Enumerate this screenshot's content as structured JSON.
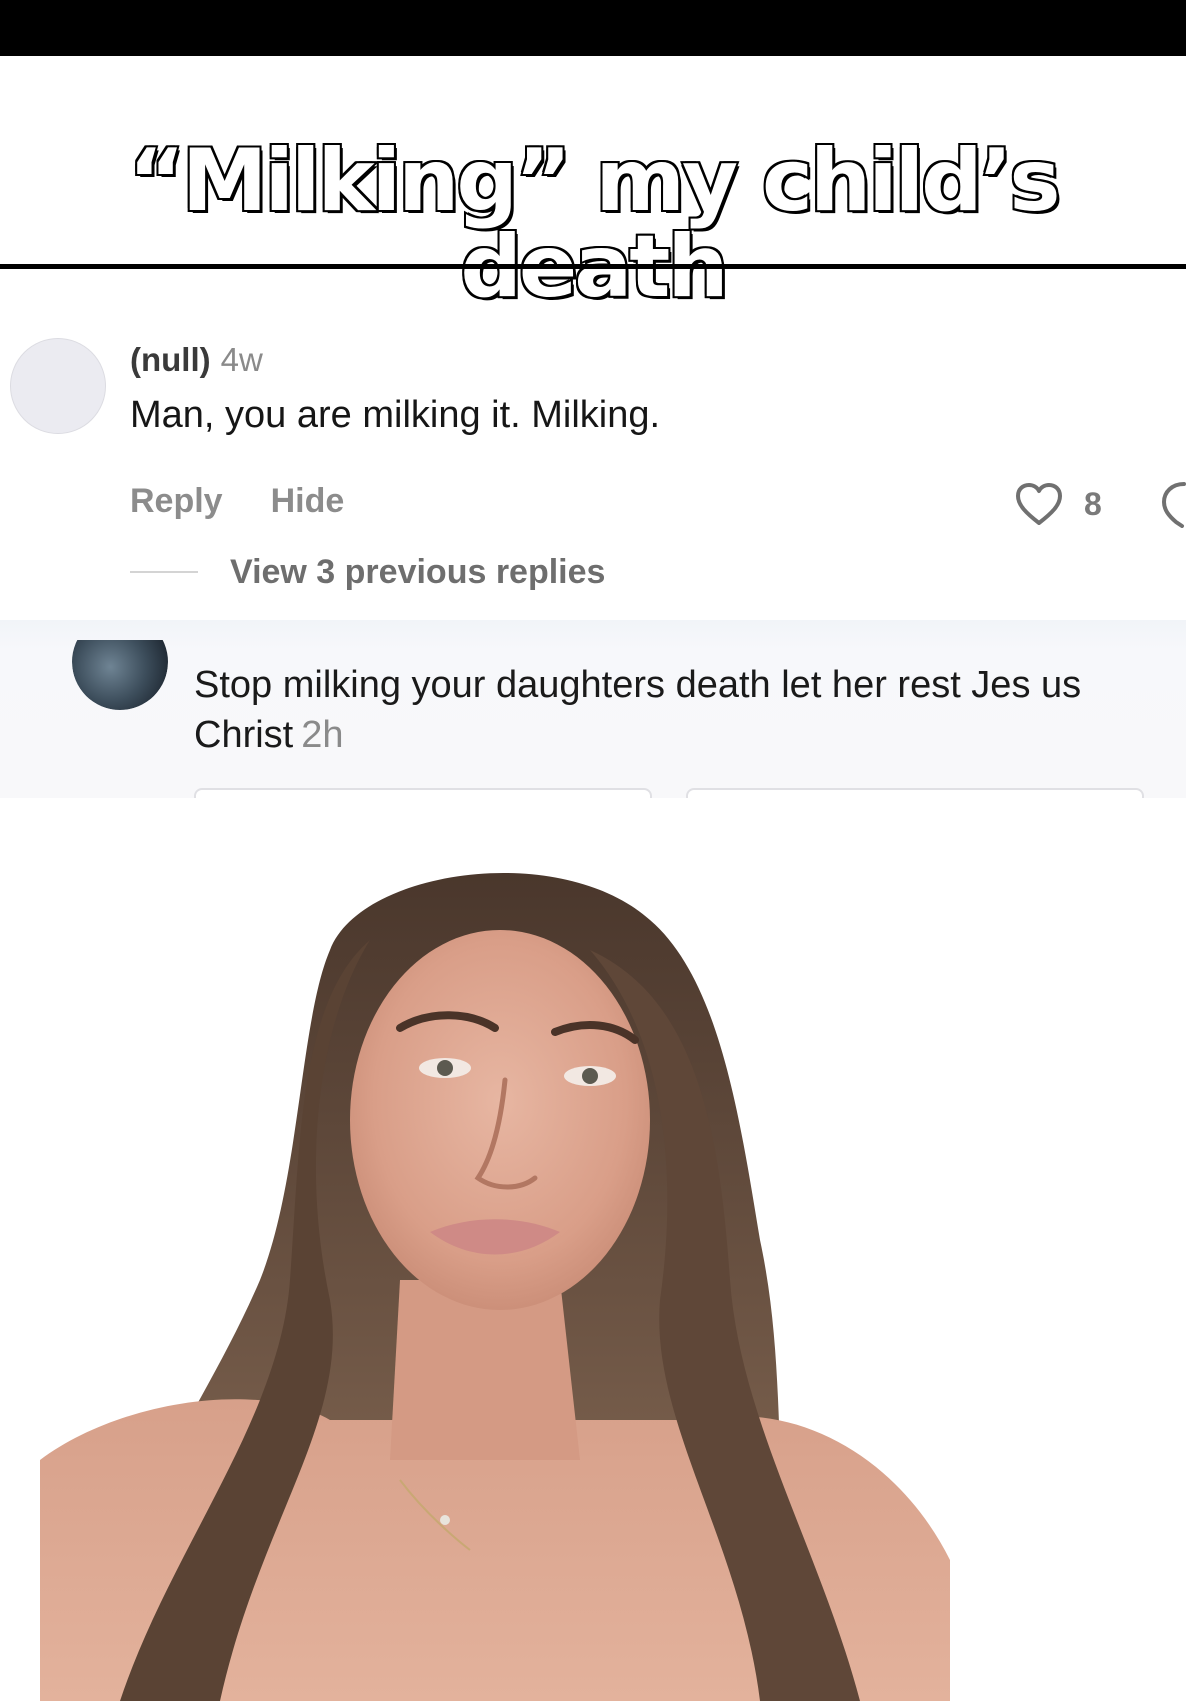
{
  "overlay": {
    "title": "“Milking” my child’s death"
  },
  "comment": {
    "username": "(null)",
    "time": "4w",
    "text": "Man, you are milking it.  Milking.",
    "reply_label": "Reply",
    "hide_label": "Hide",
    "like_count": "8",
    "view_replies_label": "View 3 previous replies"
  },
  "reply": {
    "text": "Stop milking your daughters death let her rest Jes us Christ",
    "time": "2h"
  },
  "icons": {
    "like": "heart-outline-icon",
    "dislike": "dislike-icon"
  },
  "colors": {
    "title_fill": "#ffffff",
    "title_stroke": "#000000",
    "muted_text": "#8a8a8a",
    "reply_card_bg": "#f8f8fa"
  }
}
